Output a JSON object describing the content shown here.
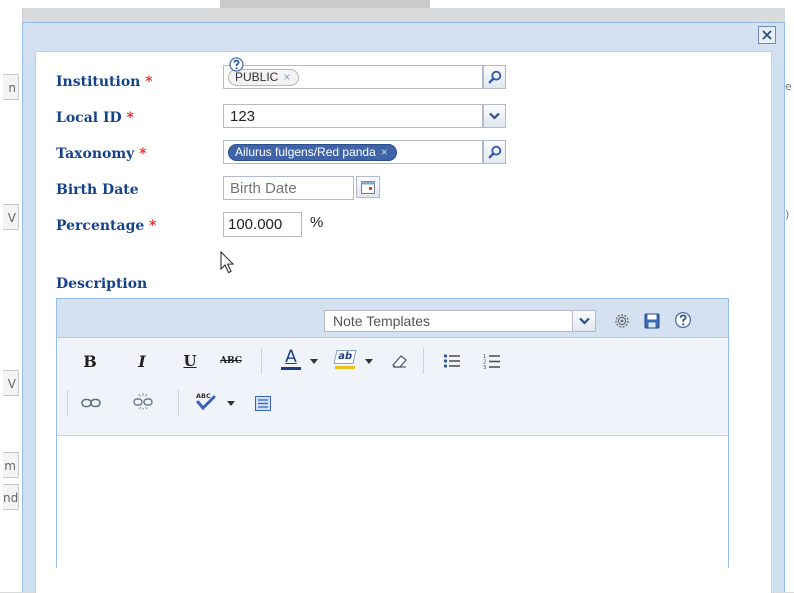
{
  "background": {
    "left_fragments": [
      "n",
      "V",
      "V",
      "m",
      "nd"
    ],
    "right_fragments": [
      "e",
      ")"
    ]
  },
  "form": {
    "institution": {
      "label": "Institution",
      "required_mark": "*",
      "chip": "PUBLIC",
      "chip_remove": "×"
    },
    "local_id": {
      "label": "Local ID",
      "required_mark": "*",
      "value": "123"
    },
    "taxonomy": {
      "label": "Taxonomy",
      "required_mark": "*",
      "chip": "Ailurus fulgens/Red panda",
      "chip_remove": "×"
    },
    "birth_date": {
      "label": "Birth Date",
      "placeholder": "Birth Date"
    },
    "percentage": {
      "label": "Percentage",
      "required_mark": "*",
      "value": "100.000",
      "unit": "%"
    },
    "description": {
      "label": "Description"
    }
  },
  "editor": {
    "templates_placeholder": "Note Templates",
    "toolbar": {
      "bold": "B",
      "italic": "I",
      "underline": "U",
      "strike": "ABC",
      "font_color": "A",
      "highlight": "ab"
    }
  },
  "colors": {
    "label": "#15428b",
    "required": "#e02020",
    "chip_selected": "#3f65a8",
    "panel_header": "#d3e1f1"
  }
}
